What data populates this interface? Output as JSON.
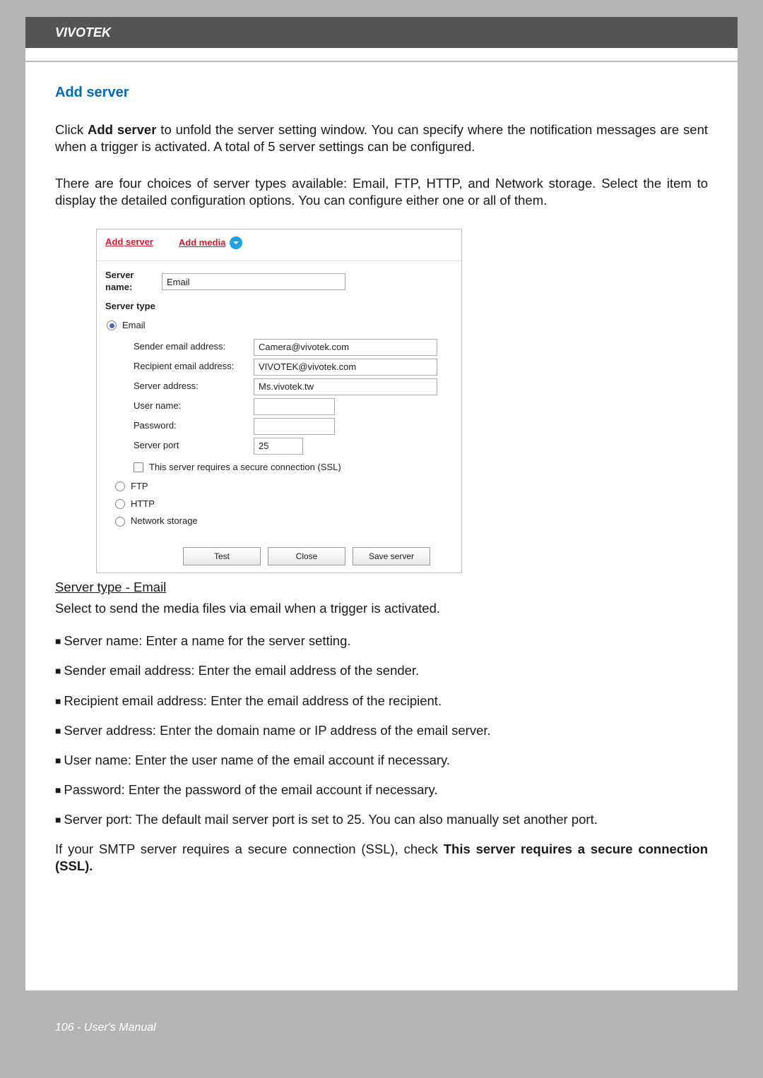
{
  "header": {
    "brand": "VIVOTEK"
  },
  "section": {
    "title": "Add server"
  },
  "para1": "Click Add server to unfold the server setting window. You can specify where the notification messages are sent when a trigger is activated. A total of 5 server settings can be configured.",
  "para1_prefix": "Click ",
  "para1_bold": "Add server",
  "para1_suffix": " to unfold the server setting window. You can specify where the notification messages are sent when a trigger is activated. A total of 5 server settings can be configured.",
  "para2": "There are four choices of server types available: Email, FTP, HTTP, and Network storage. Select the item to display the detailed configuration options. You can configure either one or all of them.",
  "shot": {
    "tabs": {
      "add_server": "Add server",
      "add_media": "Add media"
    },
    "server_name_label": "Server name:",
    "server_name_value": "Email",
    "server_type_label": "Server type",
    "types": {
      "email": "Email",
      "ftp": "FTP",
      "http": "HTTP",
      "network": "Network storage"
    },
    "fields": {
      "sender_label": "Sender email address:",
      "sender_value": "Camera@vivotek.com",
      "recipient_label": "Recipient email address:",
      "recipient_value": "VIVOTEK@vivotek.com",
      "address_label": "Server address:",
      "address_value": "Ms.vivotek.tw",
      "user_label": "User name:",
      "user_value": "",
      "pass_label": "Password:",
      "pass_value": "",
      "port_label": "Server port",
      "port_value": "25",
      "ssl_label": "This server requires a secure connection (SSL)"
    },
    "buttons": {
      "test": "Test",
      "close": "Close",
      "save": "Save server"
    }
  },
  "after": {
    "hdr": "Server type - Email",
    "line": "Select to send the media files via email when a trigger is activated.",
    "bullets": [
      "Server name: Enter a name for the server setting.",
      "Sender email address: Enter the email address of the sender.",
      "Recipient email address: Enter the email address of the recipient.",
      "Server address: Enter the domain name or IP address of the email server.",
      "User name: Enter the user name of the email account if necessary.",
      "Password: Enter the password of the email account if necessary.",
      "Server port: The default mail server port is set to 25. You can also manually set another port."
    ],
    "ssl_prefix": "If your SMTP server requires a secure connection (SSL), check ",
    "ssl_bold": "This server requires a secure connection (SSL)."
  },
  "footer": {
    "text": "106 - User's Manual"
  }
}
